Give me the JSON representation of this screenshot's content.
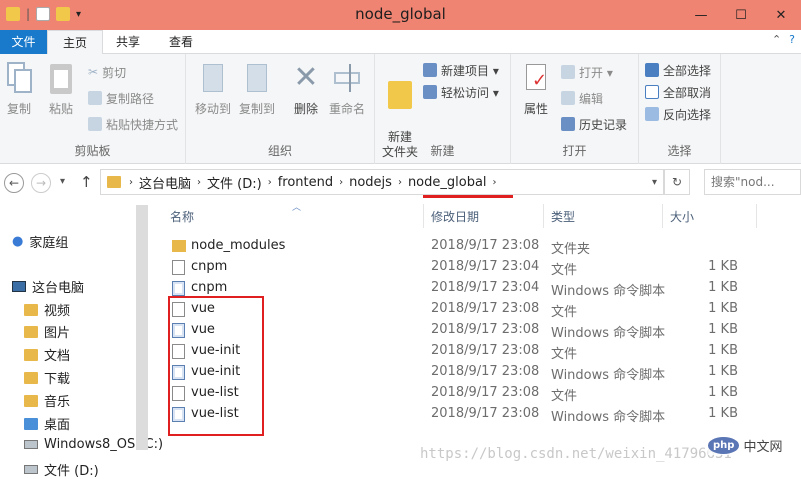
{
  "window": {
    "title": "node_global",
    "minimize": "—",
    "maximize": "☐",
    "close": "✕"
  },
  "tabs": {
    "file": "文件",
    "home": "主页",
    "share": "共享",
    "view": "查看"
  },
  "ribbon": {
    "clipboard": {
      "label": "剪贴板",
      "copy": "复制",
      "paste": "粘贴",
      "cut": "剪切",
      "copy_path": "复制路径",
      "paste_shortcut": "粘贴快捷方式"
    },
    "organize": {
      "label": "组织",
      "move_to": "移动到",
      "copy_to": "复制到",
      "delete": "删除",
      "rename": "重命名"
    },
    "new": {
      "label": "新建",
      "new_folder": "新建\n文件夹",
      "new_item": "新建项目 ▾",
      "easy_access": "轻松访问 ▾"
    },
    "open": {
      "label": "打开",
      "properties": "属性",
      "open": "打开 ▾",
      "edit": "编辑",
      "history": "历史记录"
    },
    "select": {
      "label": "选择",
      "select_all": "全部选择",
      "select_none": "全部取消",
      "invert": "反向选择"
    }
  },
  "address": {
    "back": "←",
    "forward": "→",
    "recent": "▾",
    "up": "↑",
    "crumbs": [
      "这台电脑",
      "文件 (D:)",
      "frontend",
      "nodejs",
      "node_global"
    ],
    "search_placeholder": "搜索\"nod...",
    "refresh": "↻"
  },
  "nav": {
    "homegroup": "家庭组",
    "thispc": "这台电脑",
    "items": [
      "视频",
      "图片",
      "文档",
      "下载",
      "音乐",
      "桌面",
      "Windows8_OS (C:)",
      "文件 (D:)"
    ]
  },
  "columns": {
    "name": "名称",
    "date": "修改日期",
    "type": "类型",
    "size": "大小"
  },
  "files": [
    {
      "name": "node_modules",
      "date": "2018/9/17 23:08",
      "type": "文件夹",
      "size": "",
      "icon": "folder-icon"
    },
    {
      "name": "cnpm",
      "date": "2018/9/17 23:04",
      "type": "文件",
      "size": "1 KB",
      "icon": "file-icon"
    },
    {
      "name": "cnpm",
      "date": "2018/9/17 23:04",
      "type": "Windows 命令脚本",
      "size": "1 KB",
      "icon": "script-icon"
    },
    {
      "name": "vue",
      "date": "2018/9/17 23:08",
      "type": "文件",
      "size": "1 KB",
      "icon": "file-icon"
    },
    {
      "name": "vue",
      "date": "2018/9/17 23:08",
      "type": "Windows 命令脚本",
      "size": "1 KB",
      "icon": "script-icon"
    },
    {
      "name": "vue-init",
      "date": "2018/9/17 23:08",
      "type": "文件",
      "size": "1 KB",
      "icon": "file-icon"
    },
    {
      "name": "vue-init",
      "date": "2018/9/17 23:08",
      "type": "Windows 命令脚本",
      "size": "1 KB",
      "icon": "script-icon"
    },
    {
      "name": "vue-list",
      "date": "2018/9/17 23:08",
      "type": "文件",
      "size": "1 KB",
      "icon": "file-icon"
    },
    {
      "name": "vue-list",
      "date": "2018/9/17 23:08",
      "type": "Windows 命令脚本",
      "size": "1 KB",
      "icon": "script-icon"
    }
  ],
  "watermark": "https://blog.csdn.net/weixin_41796631",
  "badge": {
    "logo": "php",
    "text": "中文网"
  },
  "colors": {
    "titlebar": "#f08472",
    "file_tab": "#1979ca",
    "highlight": "#e02020"
  }
}
